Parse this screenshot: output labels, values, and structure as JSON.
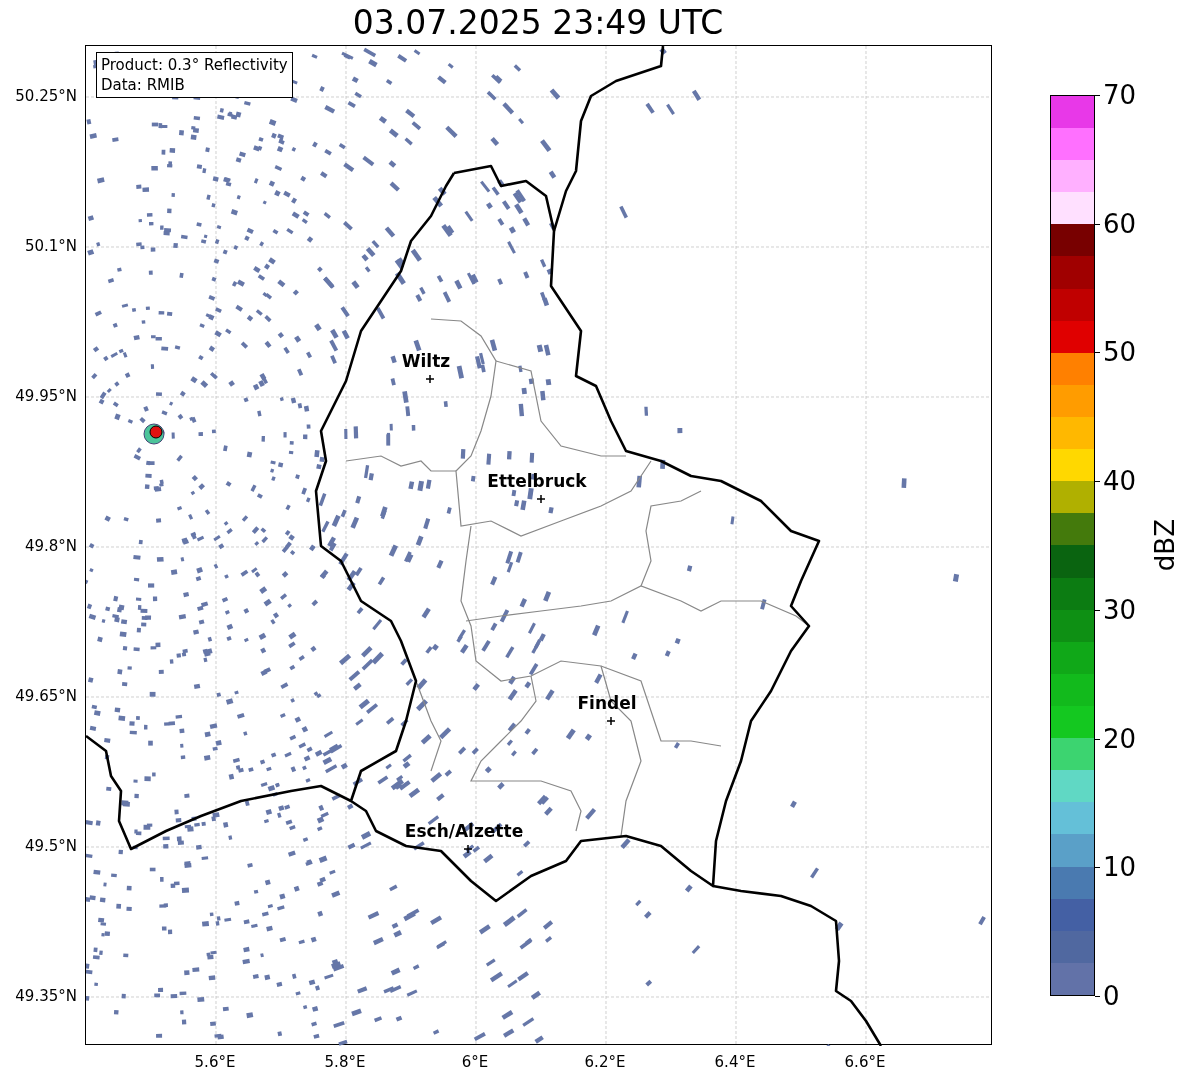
{
  "title": "03.07.2025 23:49 UTC",
  "map": {
    "info": [
      "Product: 0.3° Reflectivity",
      "Data: RMIB"
    ],
    "lat_ticks": [
      "50.25°N",
      "50.1°N",
      "49.95°N",
      "49.8°N",
      "49.65°N",
      "49.5°N",
      "49.35°N"
    ],
    "lon_ticks": [
      "5.6°E",
      "5.8°E",
      "6°E",
      "6.2°E",
      "6.4°E",
      "6.6°E"
    ],
    "cities": [
      {
        "name": "Wiltz"
      },
      {
        "name": "Ettelbruck"
      },
      {
        "name": "Findel"
      },
      {
        "name": "Esch/Alzette"
      }
    ]
  },
  "colorbar": {
    "label": "dBZ",
    "ticks": [
      "70",
      "60",
      "50",
      "40",
      "30",
      "20",
      "10",
      "0"
    ],
    "bands": [
      {
        "color": "#6272a8"
      },
      {
        "color": "#5068a0"
      },
      {
        "color": "#4460a4"
      },
      {
        "color": "#4a7ab0"
      },
      {
        "color": "#5aa0c8"
      },
      {
        "color": "#64c0d8"
      },
      {
        "color": "#60d8c4"
      },
      {
        "color": "#3cd470"
      },
      {
        "color": "#14c820"
      },
      {
        "color": "#12ba1c"
      },
      {
        "color": "#10a818"
      },
      {
        "color": "#0e9014"
      },
      {
        "color": "#0c7c12"
      },
      {
        "color": "#0a6410"
      },
      {
        "color": "#447a0c"
      },
      {
        "color": "#b0b000"
      },
      {
        "color": "#ffd800"
      },
      {
        "color": "#ffb800"
      },
      {
        "color": "#ff9c00"
      },
      {
        "color": "#ff8000"
      },
      {
        "color": "#e00000"
      },
      {
        "color": "#c00000"
      },
      {
        "color": "#a00000"
      },
      {
        "color": "#780000"
      },
      {
        "color": "#ffe0ff"
      },
      {
        "color": "#ffb0ff"
      },
      {
        "color": "#ff70ff"
      },
      {
        "color": "#e838e8"
      }
    ]
  }
}
